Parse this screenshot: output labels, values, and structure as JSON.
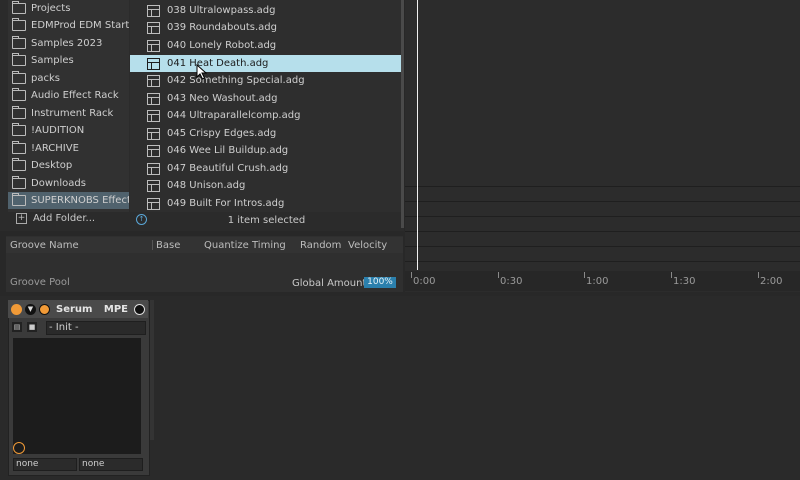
{
  "browser": {
    "places": [
      {
        "label": "Projects"
      },
      {
        "label": "EDMProd EDM Start"
      },
      {
        "label": "Samples 2023"
      },
      {
        "label": "Samples"
      },
      {
        "label": "packs"
      },
      {
        "label": "Audio Effect Rack"
      },
      {
        "label": "Instrument Rack"
      },
      {
        "label": "!AUDITION"
      },
      {
        "label": "!ARCHIVE"
      },
      {
        "label": "Desktop"
      },
      {
        "label": "Downloads"
      },
      {
        "label": "SUPERKNOBS Effect",
        "selected": true
      }
    ],
    "add_folder_label": "Add Folder...",
    "files": [
      {
        "label": "038 Ultralowpass.adg"
      },
      {
        "label": "039 Roundabouts.adg"
      },
      {
        "label": "040 Lonely Robot.adg"
      },
      {
        "label": "041 Heat Death.adg",
        "selected": true
      },
      {
        "label": "042 Something Special.adg"
      },
      {
        "label": "043 Neo Washout.adg"
      },
      {
        "label": "044 Ultraparallelcomp.adg"
      },
      {
        "label": "045 Crispy Edges.adg"
      },
      {
        "label": "046 Wee Lil Buildup.adg"
      },
      {
        "label": "047 Beautiful Crush.adg"
      },
      {
        "label": "048 Unison.adg"
      },
      {
        "label": "049 Built For Intros.adg"
      }
    ],
    "status": "1 item selected",
    "colors": {
      "selected_file": "#b6dfeb",
      "selected_place": "#50626d"
    }
  },
  "groove_pool": {
    "columns": [
      "Groove Name",
      "Base",
      "Quantize",
      "Timing",
      "Random",
      "Velocity"
    ],
    "title": "Groove Pool",
    "global_amount_label": "Global Amount",
    "global_amount_value": "100%"
  },
  "timeline": {
    "ticks": [
      "0:00",
      "0:30",
      "1:00",
      "1:30",
      "2:00"
    ]
  },
  "device": {
    "name": "Serum",
    "mpe_label": "MPE",
    "preset": "- Init -",
    "outputs": [
      "none",
      "none"
    ],
    "colors": {
      "power": "#f19a37",
      "accent": "#2b80ad"
    }
  }
}
